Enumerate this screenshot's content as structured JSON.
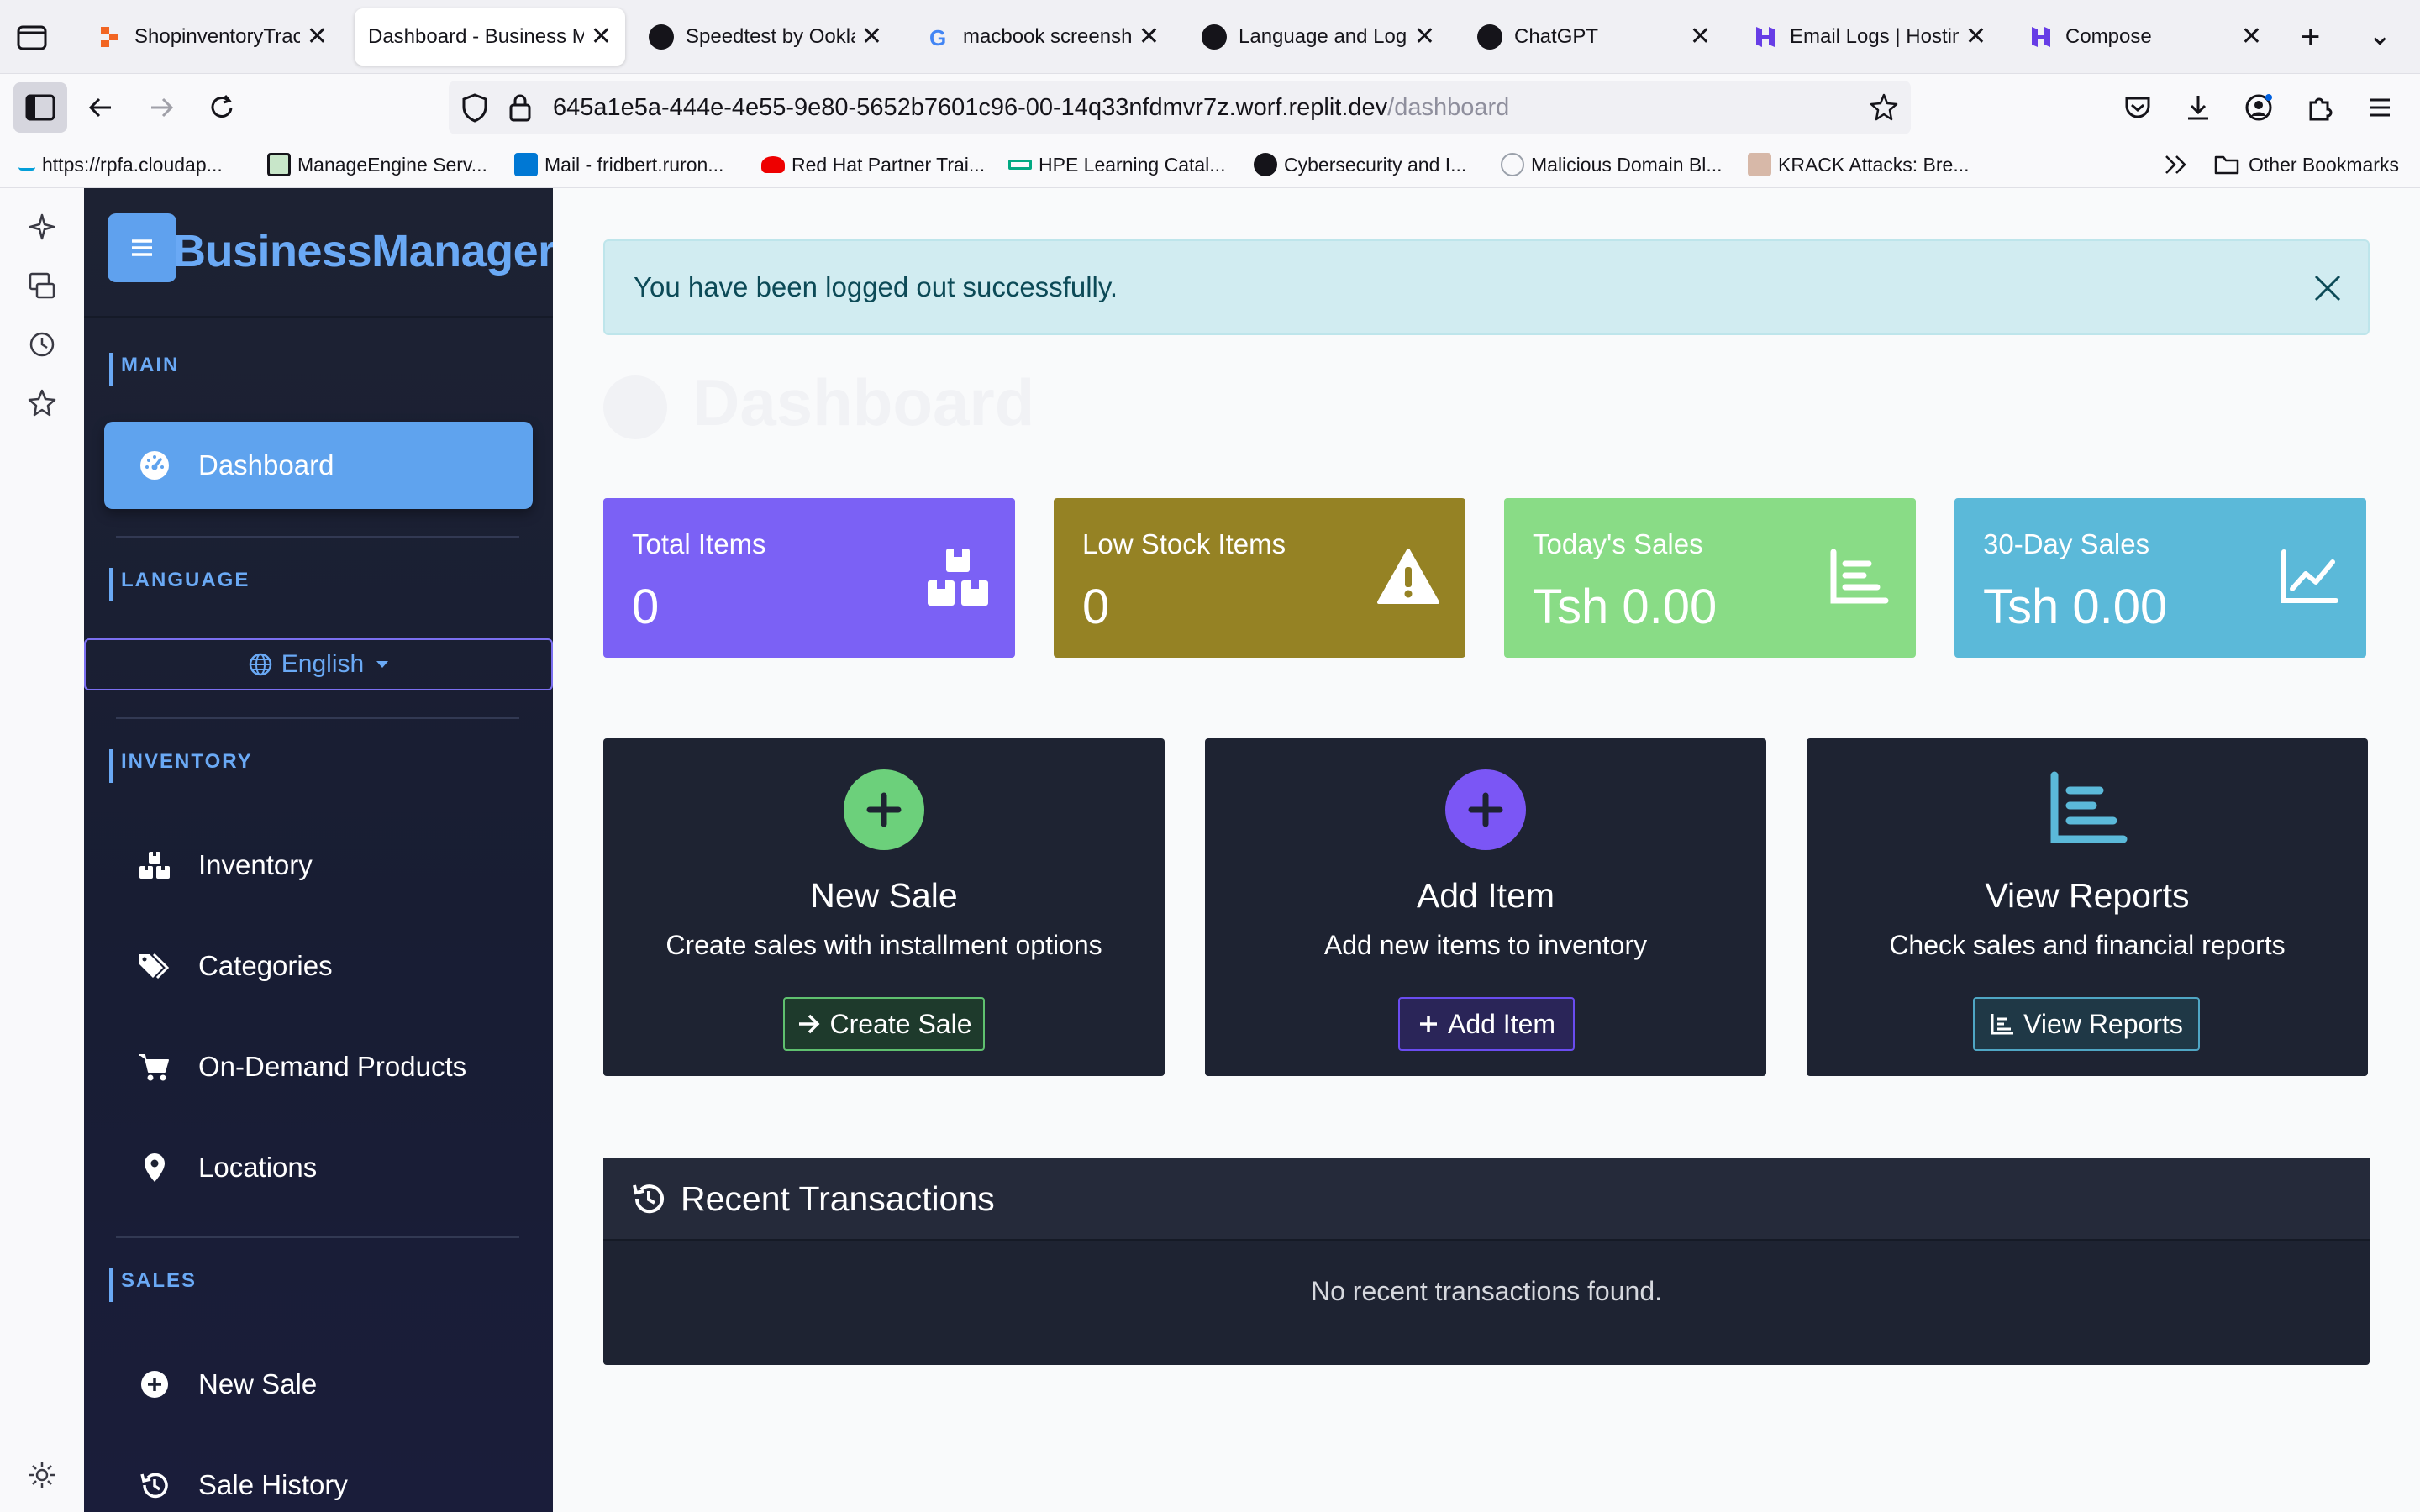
{
  "browser": {
    "tabs": [
      {
        "title": "ShopinventoryTracke",
        "favicon_color": "#f26522"
      },
      {
        "title": "Dashboard - Business M",
        "favicon_color": "#ffffff"
      },
      {
        "title": "Speedtest by Ookla",
        "favicon_color": "#15141a"
      },
      {
        "title": "macbook screensho",
        "favicon_color": "#4285f4"
      },
      {
        "title": "Language and Logo",
        "favicon_color": "#15141a"
      },
      {
        "title": "ChatGPT",
        "favicon_color": "#15141a"
      },
      {
        "title": "Email Logs | Hosting",
        "favicon_color": "#673de6"
      },
      {
        "title": "Compose",
        "favicon_color": "#673de6"
      }
    ],
    "url_main": "645a1e5a-444e-4e55-9e80-5652b7601c96-00-14q33nfdmvr7z.worf.replit.dev",
    "url_path": "/dashboard",
    "bookmarks": [
      {
        "label": "https://rpfa.cloudap...",
        "color": "#049fd9"
      },
      {
        "label": "ManageEngine Serv...",
        "color": "#2e7d32"
      },
      {
        "label": "Mail - fridbert.ruron...",
        "color": "#0078d4"
      },
      {
        "label": "Red Hat Partner Trai...",
        "color": "#ee0000"
      },
      {
        "label": "HPE Learning Catal...",
        "color": "#01a982"
      },
      {
        "label": "Cybersecurity and I...",
        "color": "#15141a"
      },
      {
        "label": "Malicious Domain Bl...",
        "color": "#9aa0aa"
      },
      {
        "label": "KRACK Attacks: Bre...",
        "color": "#8a5a44"
      }
    ],
    "other_bookmarks": "Other Bookmarks"
  },
  "sidebar": {
    "brand": "BusinessManager",
    "sections": {
      "main": "MAIN",
      "language": "LANGUAGE",
      "inventory": "INVENTORY",
      "sales": "SALES"
    },
    "dashboard": "Dashboard",
    "language_value": "English",
    "inventory_items": [
      "Inventory",
      "Categories",
      "On-Demand Products",
      "Locations"
    ],
    "sales_items": [
      "New Sale",
      "Sale History"
    ]
  },
  "alert": {
    "message": "You have been logged out successfully."
  },
  "page_title": "Dashboard",
  "stats": [
    {
      "label": "Total Items",
      "value": "0",
      "color": "#7b61f5"
    },
    {
      "label": "Low Stock Items",
      "value": "0",
      "color": "#958224"
    },
    {
      "label": "Today's Sales",
      "value": "Tsh 0.00",
      "color": "#89dc86"
    },
    {
      "label": "30-Day Sales",
      "value": "Tsh 0.00",
      "color": "#5bb9d9"
    }
  ],
  "actions": [
    {
      "title": "New Sale",
      "desc": "Create sales with installment options",
      "button": "Create Sale",
      "color": "#6cd07b"
    },
    {
      "title": "Add Item",
      "desc": "Add new items to inventory",
      "button": "Add Item",
      "color": "#7b56f5"
    },
    {
      "title": "View Reports",
      "desc": "Check sales and financial reports",
      "button": "View Reports",
      "color": "#5bb9d9"
    }
  ],
  "recent": {
    "title": "Recent Transactions",
    "empty": "No recent transactions found."
  }
}
